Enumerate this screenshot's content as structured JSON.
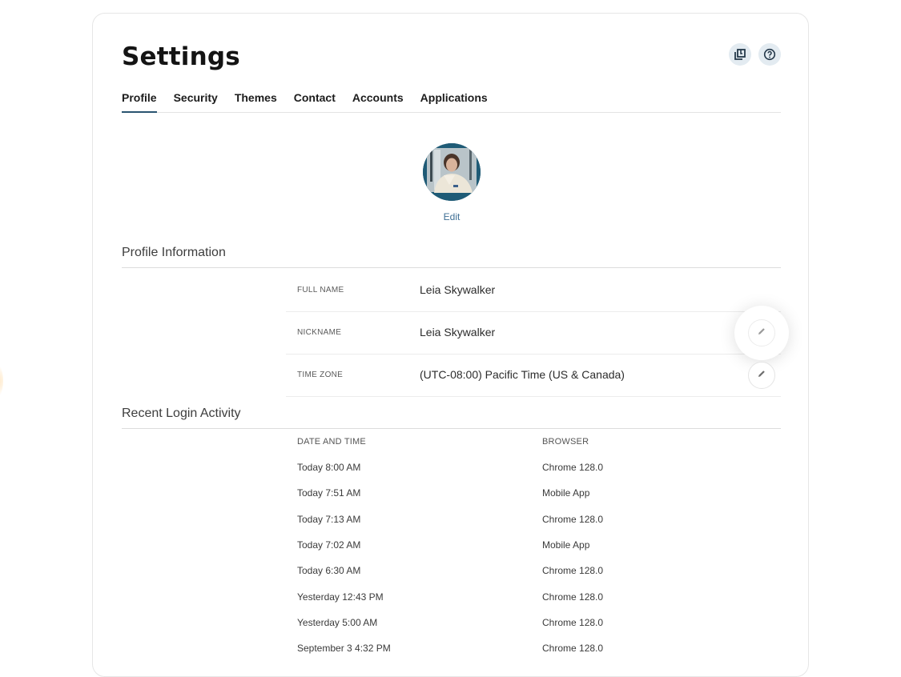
{
  "page": {
    "title": "Settings",
    "header_buttons": [
      {
        "name": "notes",
        "icon": "notes-stack-icon"
      },
      {
        "name": "help",
        "icon": "help-circle-icon"
      }
    ]
  },
  "tabs": [
    {
      "label": "Profile",
      "active": true
    },
    {
      "label": "Security",
      "active": false
    },
    {
      "label": "Themes",
      "active": false
    },
    {
      "label": "Contact",
      "active": false
    },
    {
      "label": "Accounts",
      "active": false
    },
    {
      "label": "Applications",
      "active": false
    }
  ],
  "avatar": {
    "alt": "Profile photo",
    "edit_label": "Edit"
  },
  "profile_information": {
    "heading": "Profile Information",
    "fields": [
      {
        "label": "FULL NAME",
        "value": "Leia Skywalker",
        "editable": false
      },
      {
        "label": "NICKNAME",
        "value": "Leia Skywalker",
        "editable": true,
        "hovered": true
      },
      {
        "label": "TIME ZONE",
        "value": "(UTC-08:00) Pacific Time (US & Canada)",
        "editable": true
      }
    ]
  },
  "recent_login_activity": {
    "heading": "Recent Login Activity",
    "columns": [
      "DATE AND TIME",
      "BROWSER"
    ],
    "rows": [
      {
        "datetime": "Today 8:00 AM",
        "browser": "Chrome 128.0"
      },
      {
        "datetime": "Today 7:51 AM",
        "browser": "Mobile App"
      },
      {
        "datetime": "Today 7:13 AM",
        "browser": "Chrome 128.0"
      },
      {
        "datetime": "Today 7:02 AM",
        "browser": "Mobile App"
      },
      {
        "datetime": "Today 6:30 AM",
        "browser": "Chrome 128.0"
      },
      {
        "datetime": "Yesterday 12:43 PM",
        "browser": "Chrome 128.0"
      },
      {
        "datetime": "Yesterday 5:00 AM",
        "browser": "Chrome 128.0"
      },
      {
        "datetime": "September 3 4:32 PM",
        "browser": "Chrome 128.0"
      }
    ]
  },
  "colors": {
    "accent": "#2a5470",
    "link": "#3f6f95",
    "icon_button_bg": "#e3ebf1"
  }
}
